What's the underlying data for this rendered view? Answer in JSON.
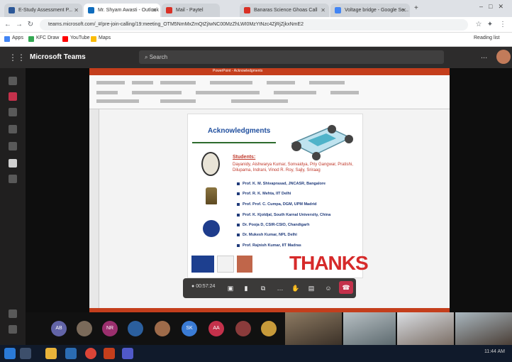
{
  "browser": {
    "tabs": [
      {
        "label": "E-Study Assessment P...",
        "color": "#2b5797",
        "active": false
      },
      {
        "label": "Mr. Shyam Awasti - Outlook",
        "color": "#0f6cbd",
        "active": true
      },
      {
        "label": "Mail - Paytel",
        "color": "#d93025",
        "active": false
      },
      {
        "label": "Banaras Science Ghoas Call",
        "color": "#d93025",
        "active": false
      },
      {
        "label": "Voltage bridge - Google Se...",
        "color": "#4285f4",
        "active": false
      }
    ],
    "url": "teams.microsoft.com/_#/pre-join-calling/19:meeting_OTM5NmMxZmQtZjIwNC00MzZhLWI0MzYtNzc4ZjRjZjkxNmE2",
    "bookmarks": [
      {
        "label": "Apps",
        "color": "#4285f4"
      },
      {
        "label": "KFC Draw",
        "color": "#34a853"
      },
      {
        "label": "YouTube",
        "color": "#ff0000"
      },
      {
        "label": "Maps",
        "color": "#fbbc05"
      }
    ],
    "reading_list": "Reading list"
  },
  "teams": {
    "app_name": "Microsoft Teams",
    "search_placeholder": "Search",
    "more_label": "..."
  },
  "ppt": {
    "window_title": "PowerPoint - Acknowledgments"
  },
  "slide": {
    "title": "Acknowledgments",
    "students_label": "Students:",
    "students_names": "Dayanidy, Aishwarya Kumar, Sonvaidya, Priy Gangwar, Pratishi, Dilupama, Indrani, Vinod R. Roy, Sajly, Sriraag",
    "acknowledgments": [
      "Prof. K. M. Shivaprasad, JNCASR, Bangalore",
      "Prof. R. K. Mehta, IIT Delhi",
      "Prof. Prof. C. Cumpa, DGM, UPM Madrid",
      "Prof. K. Kjoldjal, South Karnal University, China",
      "Dr. Pooja D, CSIR-CSIO, Chandigarh",
      "Dr. Mukesh Kumar, NPL Delhi",
      "Prof. Rajnish Kumar, IIT Madras"
    ],
    "thanks": "THANKS"
  },
  "meeting": {
    "timer": "00:57:24",
    "hangup_icon": "phone-hangup-icon"
  },
  "participants": [
    {
      "initials": "AB",
      "color": "#6264a7"
    },
    {
      "initials": "",
      "color": "#7a6a5a"
    },
    {
      "initials": "NR",
      "color": "#9b2f6e"
    },
    {
      "initials": "",
      "color": "#2b5f9e"
    },
    {
      "initials": "",
      "color": "#9e6b4a"
    },
    {
      "initials": "SK",
      "color": "#3a7bd5"
    },
    {
      "initials": "AA",
      "color": "#c4314b"
    },
    {
      "initials": "",
      "color": "#8a3b3b"
    },
    {
      "initials": "",
      "color": "#c79a3a"
    }
  ],
  "taskbar": {
    "time": "11:44 AM"
  }
}
